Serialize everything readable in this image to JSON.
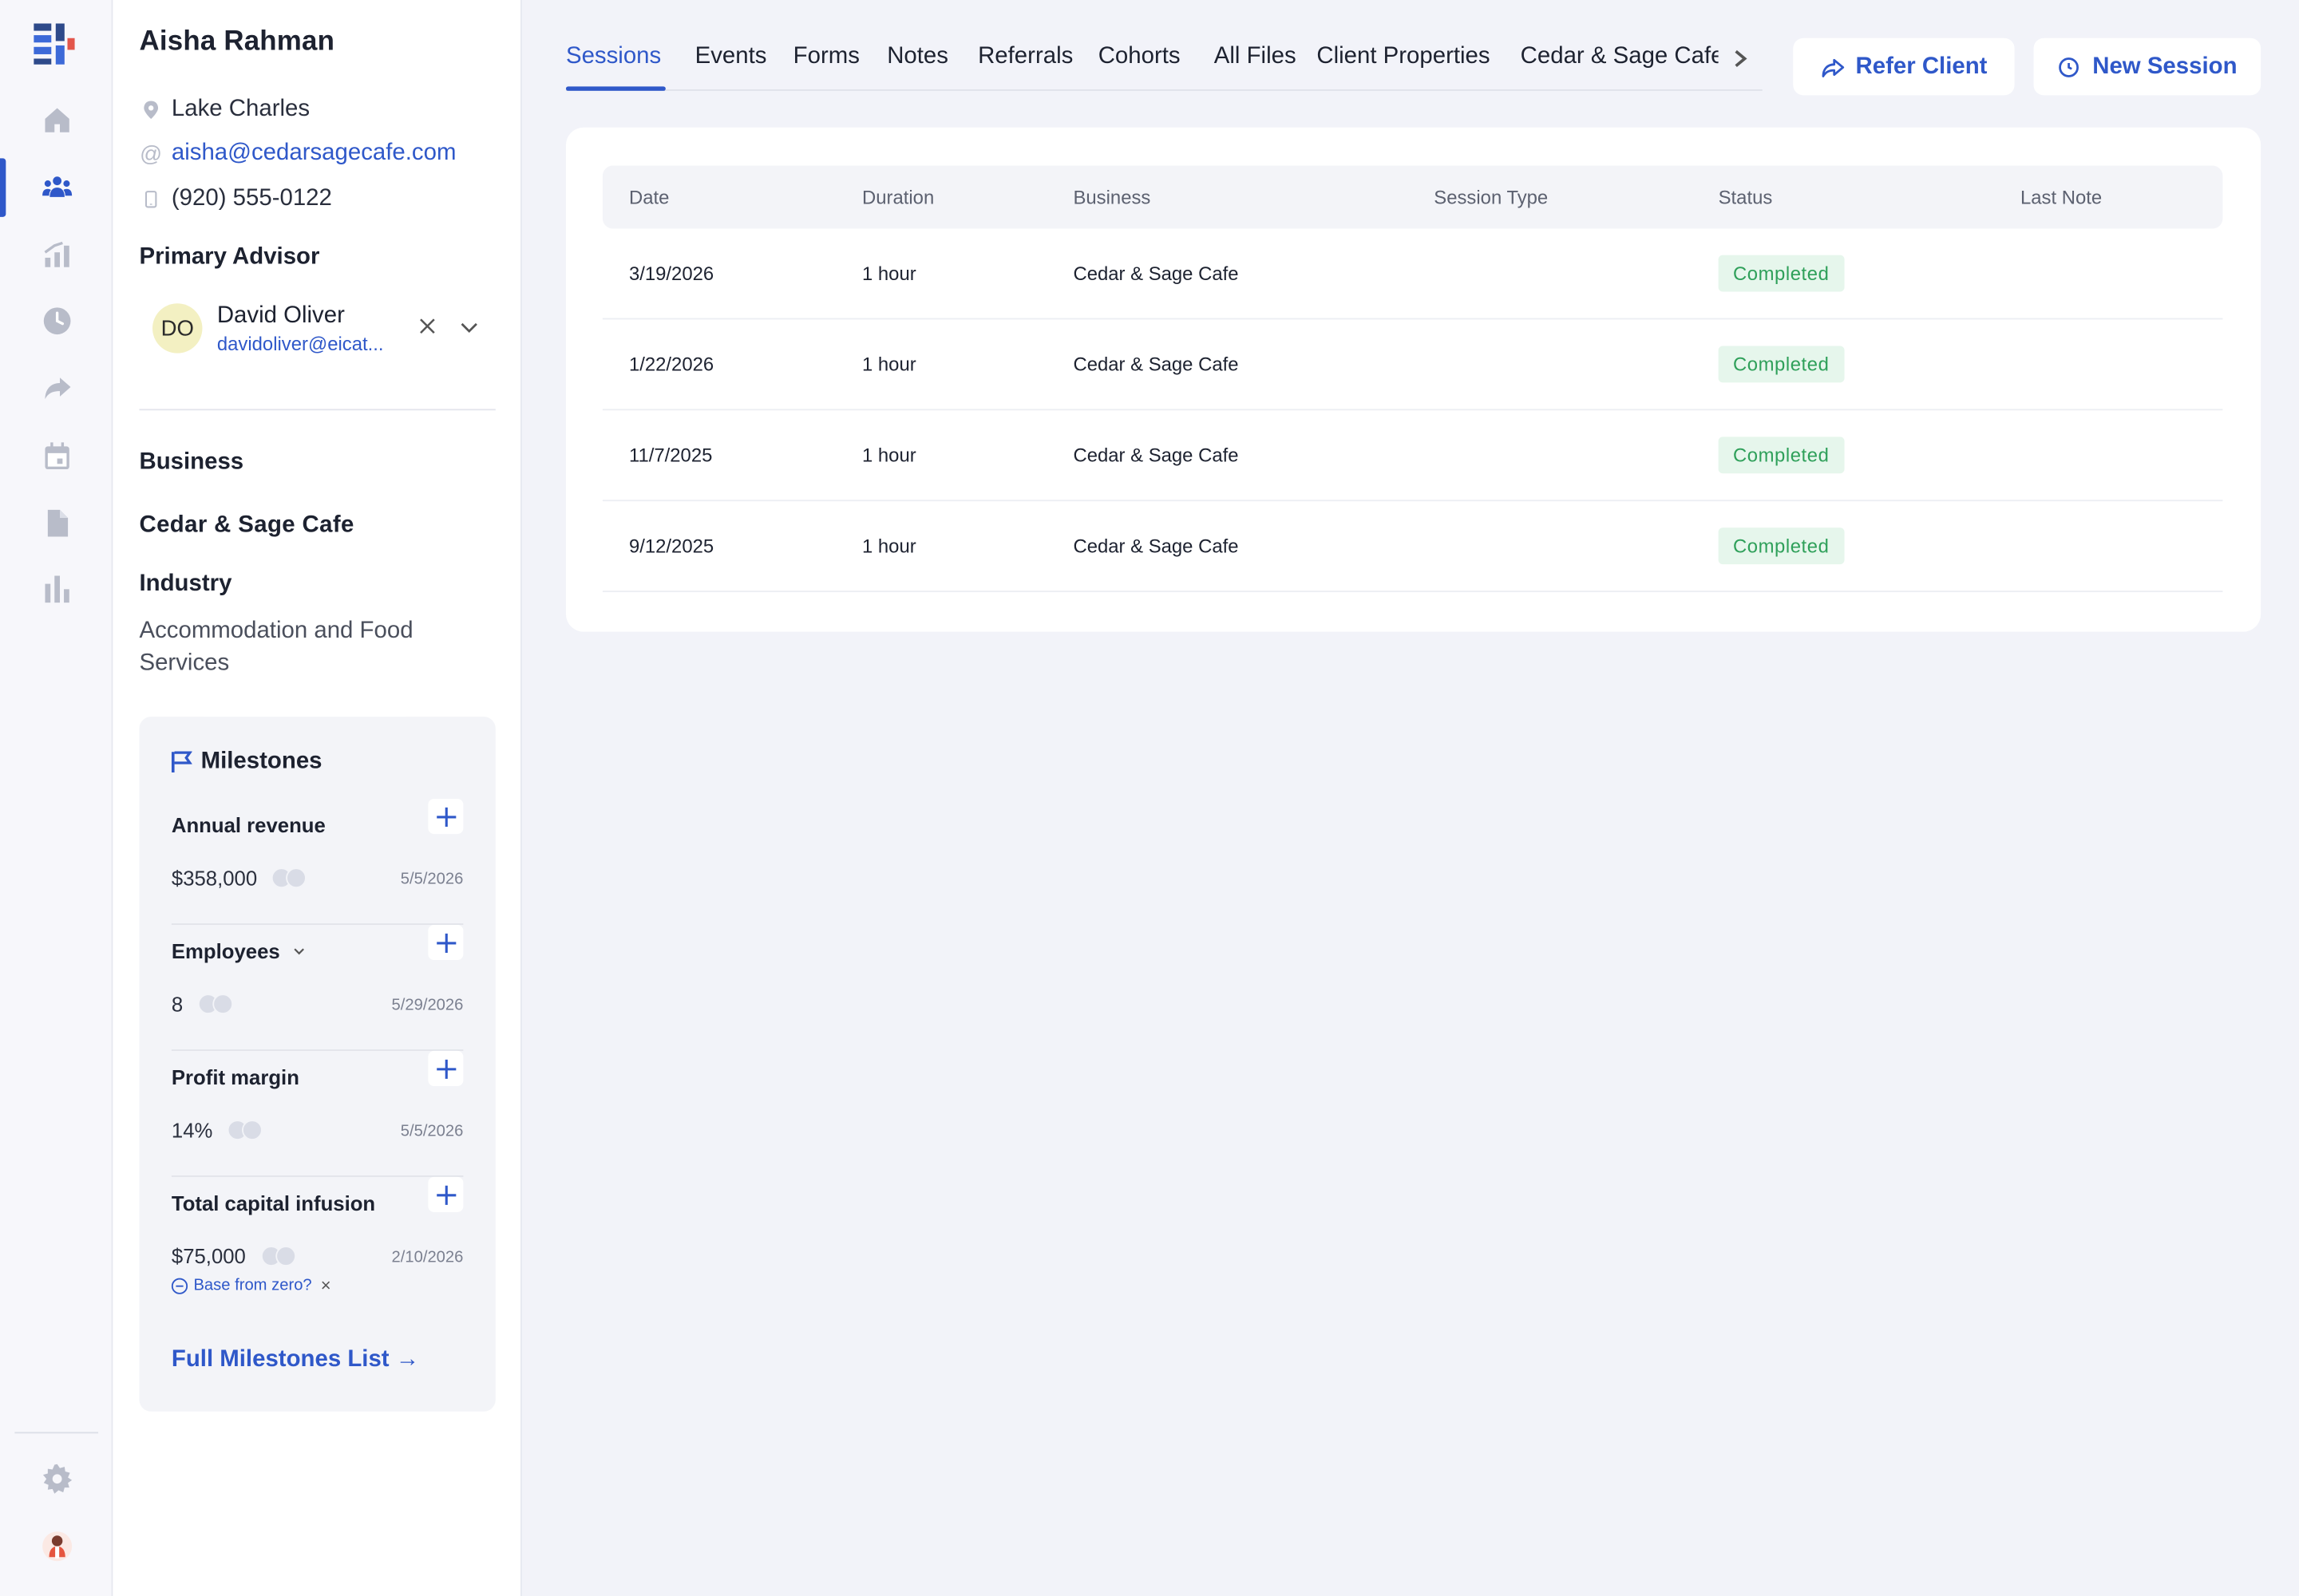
{
  "nav": {
    "items": [
      {
        "icon": "home-icon"
      },
      {
        "icon": "clients-icon",
        "active": true
      },
      {
        "icon": "stats-icon"
      },
      {
        "icon": "clock-icon"
      },
      {
        "icon": "share-icon"
      },
      {
        "icon": "calendar-icon"
      },
      {
        "icon": "file-icon"
      },
      {
        "icon": "bar-chart-icon"
      }
    ],
    "bottom": [
      {
        "icon": "gear-icon"
      },
      {
        "icon": "user-avatar-icon"
      }
    ]
  },
  "client": {
    "name": "Aisha Rahman",
    "location": "Lake Charles",
    "email": "aisha@cedarsagecafe.com",
    "phone": "(920) 555-0122"
  },
  "advisor": {
    "heading": "Primary Advisor",
    "initials": "DO",
    "name": "David Oliver",
    "email": "davidoliver@eicat..."
  },
  "business": {
    "heading": "Business",
    "name": "Cedar & Sage Cafe",
    "industry_heading": "Industry",
    "industry": "Accommodation and Food Services"
  },
  "milestones": {
    "heading": "Milestones",
    "items": [
      {
        "label": "Annual revenue",
        "value": "$358,000",
        "date": "5/5/2026"
      },
      {
        "label": "Employees",
        "value": "8",
        "date": "5/29/2026",
        "has_dropdown": true
      },
      {
        "label": "Profit margin",
        "value": "14%",
        "date": "5/5/2026"
      },
      {
        "label": "Total capital infusion",
        "value": "$75,000",
        "date": "2/10/2026"
      }
    ],
    "base_from_zero": "Base from zero?",
    "full_list": "Full Milestones List →"
  },
  "tabs": [
    "Sessions",
    "Events",
    "Forms",
    "Notes",
    "Referrals",
    "Cohorts",
    "All Files",
    "Client Properties",
    "Cedar & Sage Cafe"
  ],
  "active_tab": "Sessions",
  "actions": {
    "refer": "Refer Client",
    "new_session": "New Session"
  },
  "table": {
    "columns": [
      "Date",
      "Duration",
      "Business",
      "Session Type",
      "Status",
      "Last Note"
    ],
    "rows": [
      {
        "date": "3/19/2026",
        "duration": "1 hour",
        "business": "Cedar & Sage Cafe",
        "session_type": "",
        "status": "Completed",
        "last_note": ""
      },
      {
        "date": "1/22/2026",
        "duration": "1 hour",
        "business": "Cedar & Sage Cafe",
        "session_type": "",
        "status": "Completed",
        "last_note": ""
      },
      {
        "date": "11/7/2025",
        "duration": "1 hour",
        "business": "Cedar & Sage Cafe",
        "session_type": "",
        "status": "Completed",
        "last_note": ""
      },
      {
        "date": "9/12/2025",
        "duration": "1 hour",
        "business": "Cedar & Sage Cafe",
        "session_type": "",
        "status": "Completed",
        "last_note": ""
      }
    ]
  },
  "colors": {
    "accent": "#2f58c9",
    "status_green": "#2fa05a",
    "status_bg": "#e6f6ec",
    "nav_icon": "#b8bcc9"
  }
}
